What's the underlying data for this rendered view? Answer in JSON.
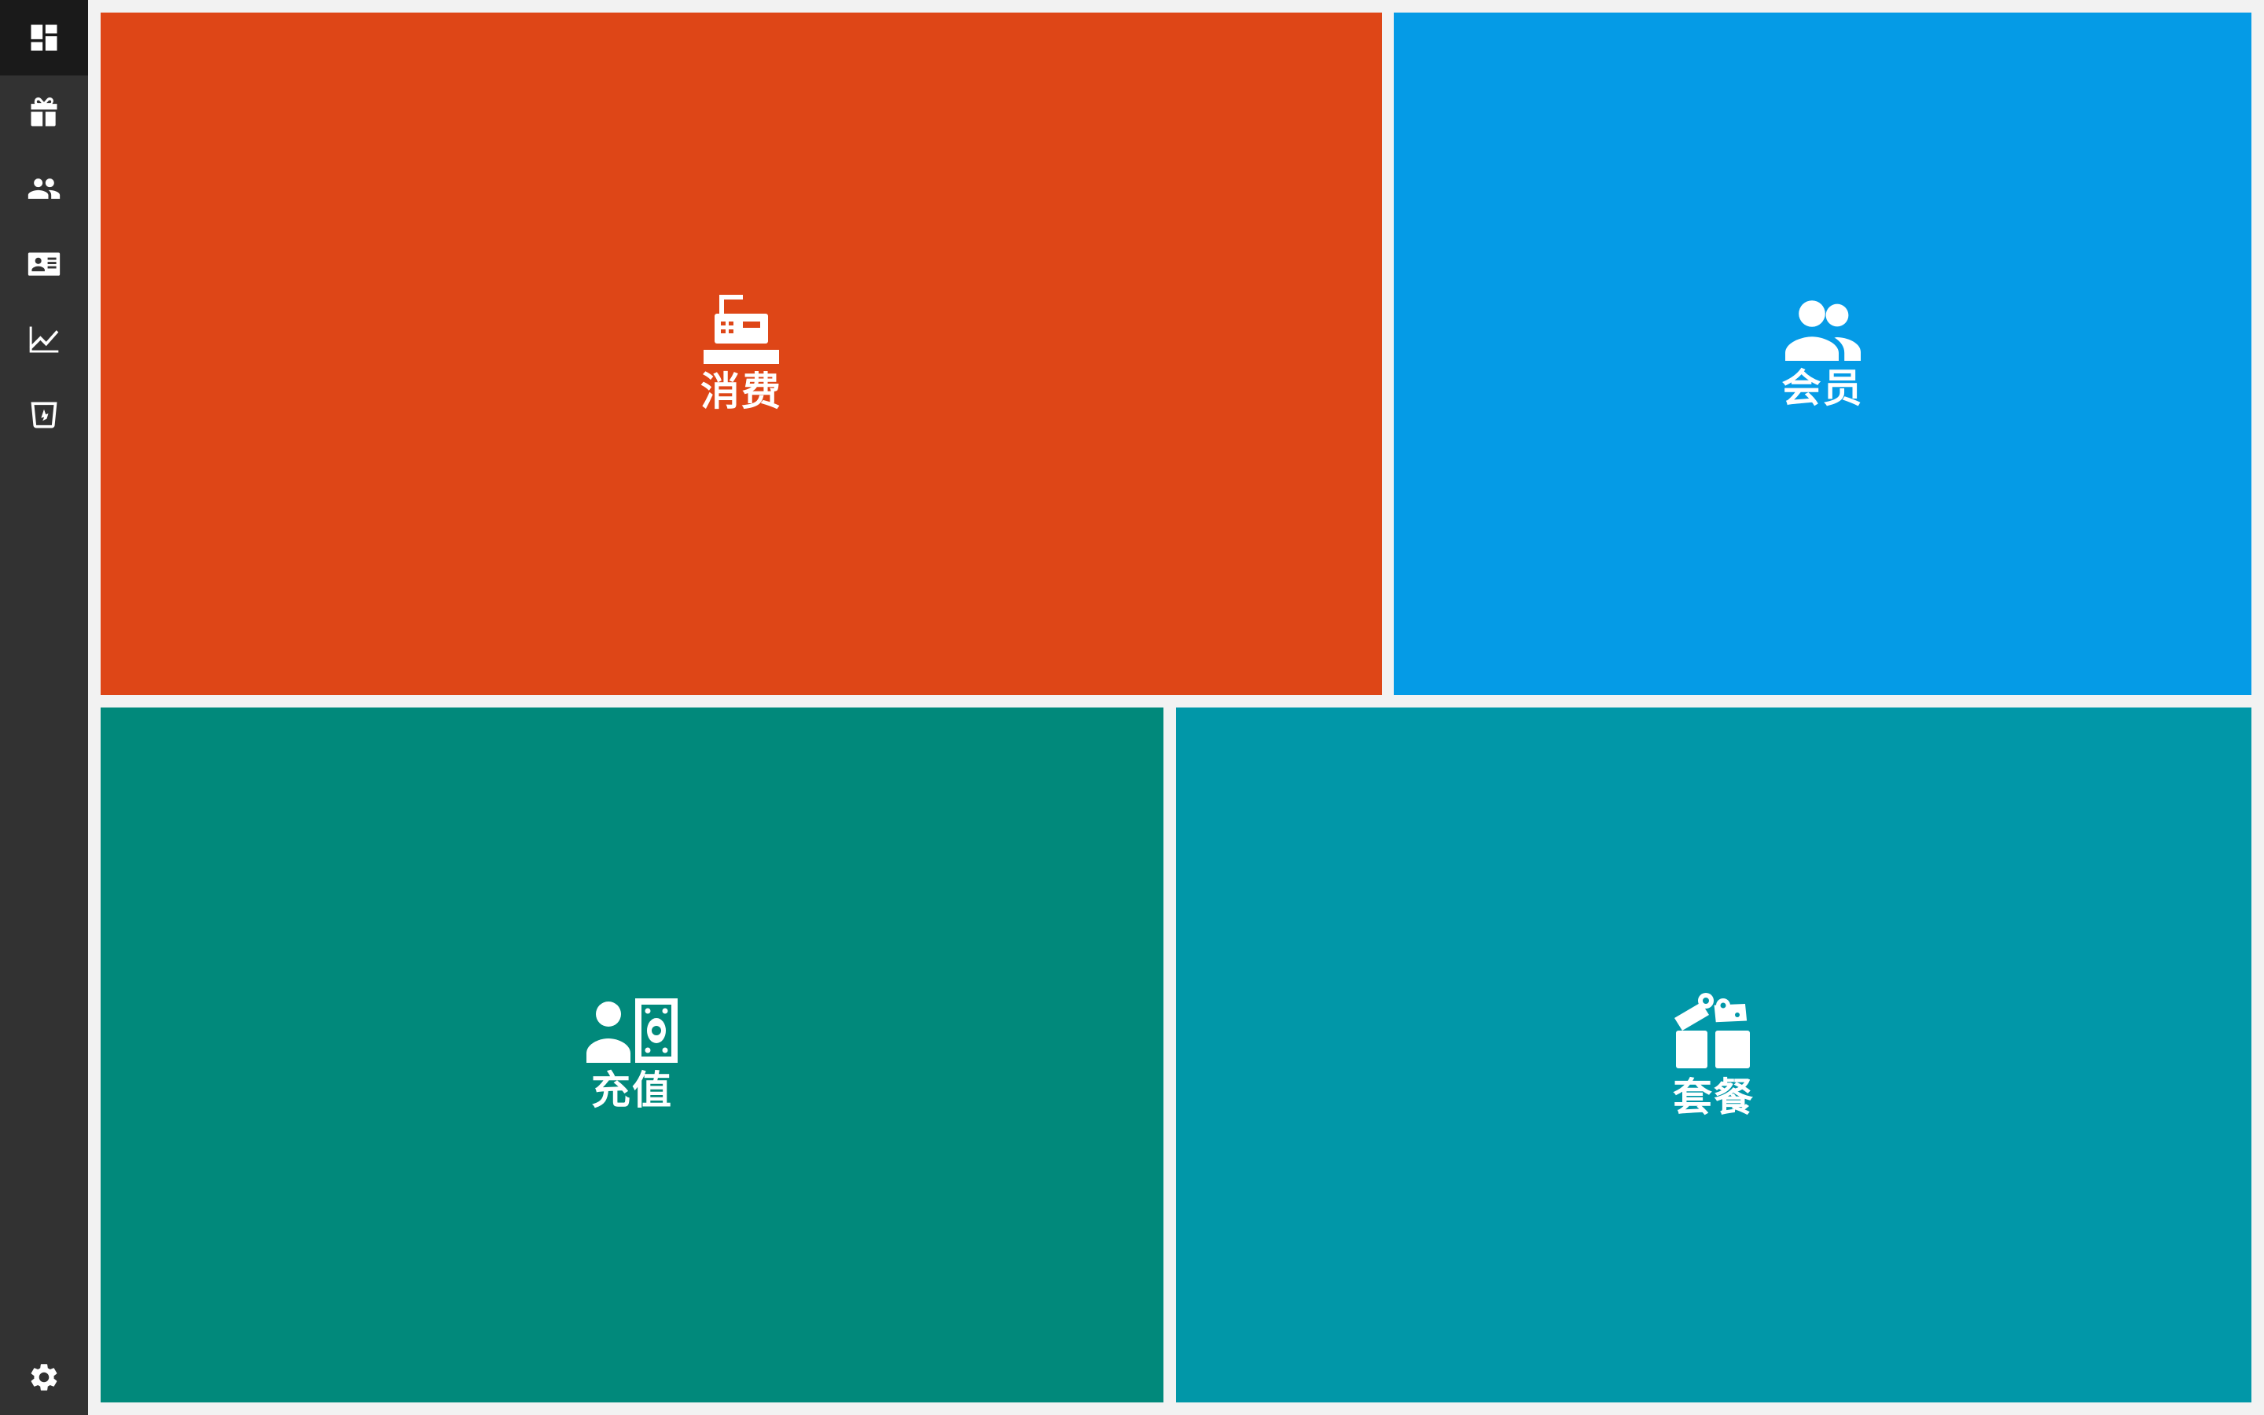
{
  "sidebar": {
    "items": [
      {
        "icon": "dashboard-icon",
        "active": true
      },
      {
        "icon": "gift-icon",
        "active": false
      },
      {
        "icon": "people-icon",
        "active": false
      },
      {
        "icon": "id-card-icon",
        "active": false
      },
      {
        "icon": "line-chart-icon",
        "active": false
      },
      {
        "icon": "shopping-bag-icon",
        "active": false
      }
    ],
    "settings": {
      "icon": "gear-icon"
    }
  },
  "tiles": [
    {
      "label": "消费",
      "icon": "cash-register-icon",
      "color": "#de4617"
    },
    {
      "label": "会员",
      "icon": "people-icon",
      "color": "#059be6"
    },
    {
      "label": "充值",
      "icon": "person-money-icon",
      "color": "#01897b"
    },
    {
      "label": "套餐",
      "icon": "gift-icon",
      "color": "#0197a8"
    }
  ],
  "colors": {
    "sidebar_bg": "#323232",
    "sidebar_active_bg": "#1a1a1a",
    "page_bg": "#f2f2f2"
  }
}
